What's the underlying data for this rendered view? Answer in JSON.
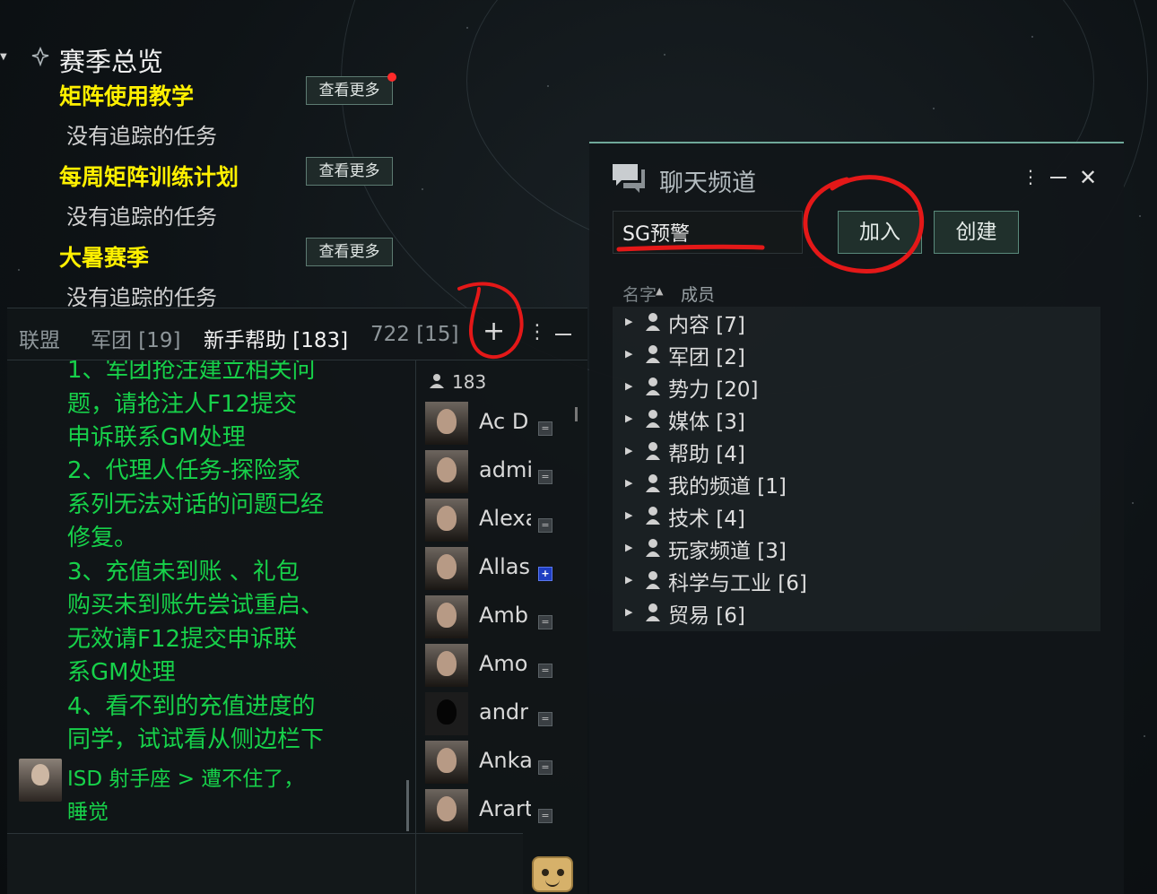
{
  "season": {
    "title": "赛季总览",
    "sections": [
      {
        "title": "矩阵使用教学",
        "status": "没有追踪的任务",
        "button": "查看更多"
      },
      {
        "title": "每周矩阵训练计划",
        "status": "没有追踪的任务",
        "button": "查看更多"
      },
      {
        "title": "大暑赛季",
        "status": "没有追踪的任务",
        "button": "查看更多"
      }
    ]
  },
  "chat_left": {
    "tabs": [
      {
        "label": "联盟"
      },
      {
        "label": "军团 [19]"
      },
      {
        "label": "新手帮助 [183]"
      },
      {
        "label": "722 [15]"
      }
    ],
    "add_symbol": "+",
    "menu_symbol": "⋮",
    "message_lines": [
      "1、军团抢注建立相关问",
      "题，请抢注人F12提交",
      "申诉联系GM处理",
      "2、代理人任务-探险家",
      "系列无法对话的问题已经",
      "修复。",
      "3、充值未到账 、礼包",
      "购买未到账先尝试重启、",
      "无效请F12提交申诉联",
      "系GM处理",
      "4、看不到的充值进度的",
      "同学，试试看从侧边栏下"
    ],
    "last_message": {
      "line1": "ISD 射手座 > 遭不住了，",
      "line2": "睡觉"
    },
    "member_count": "183",
    "members": [
      {
        "name": "Ac D",
        "tag": "="
      },
      {
        "name": "admi",
        "tag": "="
      },
      {
        "name": "Alexa",
        "tag": "="
      },
      {
        "name": "Allas",
        "tag": "+"
      },
      {
        "name": "Amb",
        "tag": "="
      },
      {
        "name": "Amo",
        "tag": "="
      },
      {
        "name": "andr",
        "tag": "="
      },
      {
        "name": "Anka",
        "tag": "="
      },
      {
        "name": "Arart",
        "tag": "="
      }
    ]
  },
  "channels": {
    "title": "聊天频道",
    "menu_symbol": "⋮",
    "close_symbol": "✕",
    "search_value": "SG预警",
    "join_label": "加入",
    "create_label": "创建",
    "col_name": "名字",
    "col_members": "成员",
    "list": [
      "内容 [7]",
      "军团 [2]",
      "势力 [20]",
      "媒体 [3]",
      "帮助 [4]",
      "我的频道 [1]",
      "技术 [4]",
      "玩家频道 [3]",
      "科学与工业 [6]",
      "贸易 [6]"
    ]
  },
  "colors": {
    "section_title": "#fff000",
    "message_text": "#17d14a",
    "annotation": "#e41818",
    "accent": "#6fa899"
  }
}
